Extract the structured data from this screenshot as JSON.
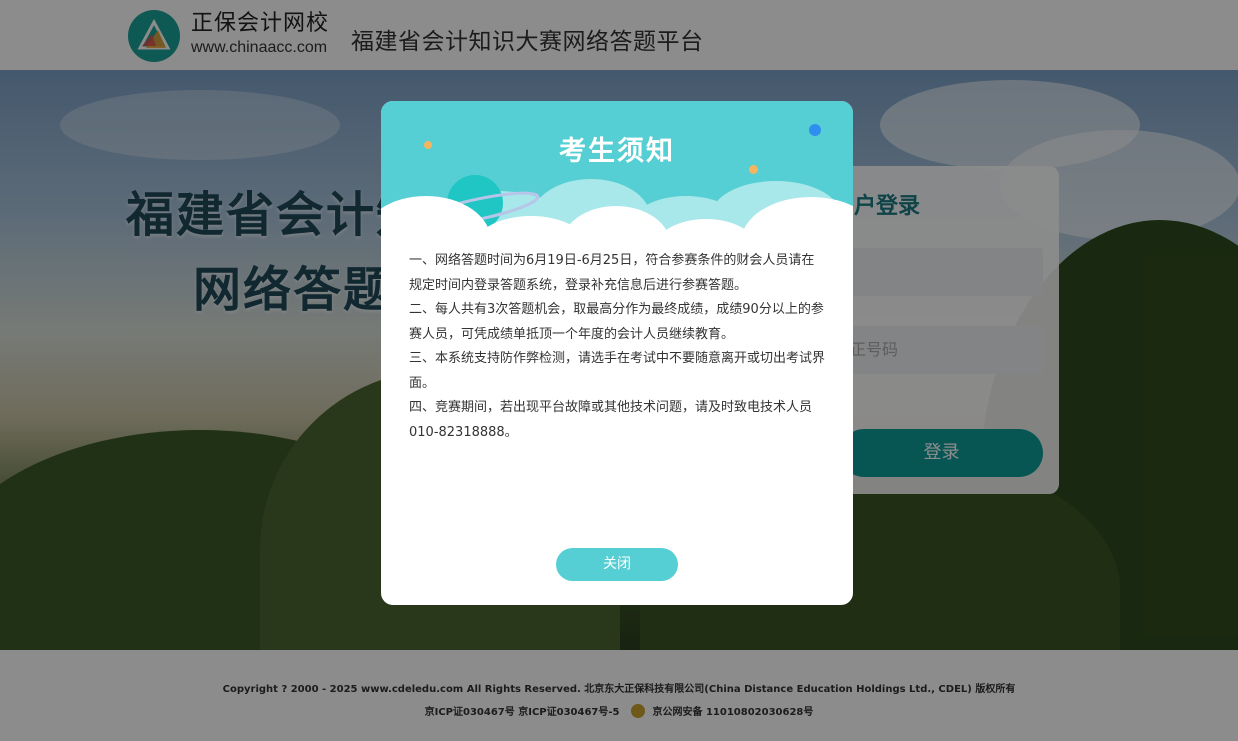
{
  "header": {
    "logo_cn": "正保会计网校",
    "logo_url": "www.chinaacc.com",
    "platform_title": "福建省会计知识大赛网络答题平台"
  },
  "hero": {
    "title_line1": "福建省会计知",
    "title_line2": "网络答题"
  },
  "login": {
    "title": "户登录",
    "field1_placeholder": "",
    "field2_placeholder": "正号码",
    "button_label": "登录"
  },
  "modal": {
    "title": "考生须知",
    "paragraphs": [
      "一、网络答题时间为6月19日-6月25日，符合参赛条件的财会人员请在规定时间内登录答题系统，登录补充信息后进行参赛答题。",
      "二、每人共有3次答题机会，取最高分作为最终成绩，成绩90分以上的参赛人员，可凭成绩单抵顶一个年度的会计人员继续教育。",
      "三、本系统支持防作弊检测，请选手在考试中不要随意离开或切出考试界面。",
      "四、竞赛期间，若出现平台故障或其他技术问题，请及时致电技术人员010-82318888。"
    ],
    "close_label": "关闭"
  },
  "footer": {
    "line1": "Copyright ? 2000 - 2025 www.cdeledu.com All Rights Reserved.    北京东大正保科技有限公司(China Distance Education Holdings Ltd., CDEL) 版权所有",
    "icp": "京ICP证030467号 京ICP证030467号-5",
    "police": "京公网安备 11010802030628号"
  },
  "colors": {
    "accent": "#55cfd3",
    "login_button": "#0f9d97",
    "overlay": "rgba(0,0,0,0.45)"
  }
}
